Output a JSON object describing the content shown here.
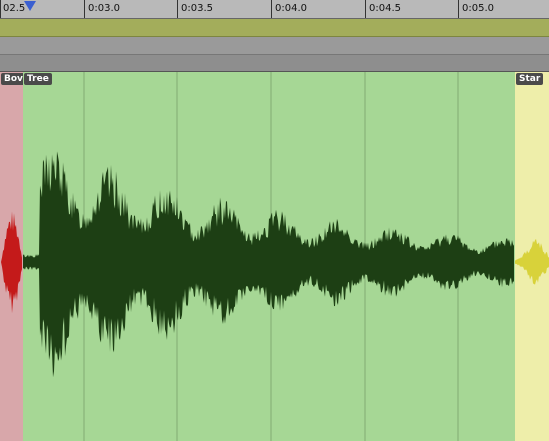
{
  "ruler": {
    "ticks": [
      "02.5",
      "0:03.0",
      "0:03.5",
      "0:04.0",
      "0:04.5",
      "0:05.0"
    ]
  },
  "regions": [
    {
      "label": "Bov",
      "color": "#d8a7aa",
      "wave_color": "#c41a1a"
    },
    {
      "label": "Tree",
      "color": "#a6d795",
      "wave_color": "#1d3f14"
    },
    {
      "label": "Star",
      "color": "#eeeeaa",
      "wave_color": "#d8d23a"
    }
  ],
  "colors": {
    "ruler_bg": "#b9b9b9",
    "olive_strip": "#a3ad5b",
    "playhead": "#3a5fd0"
  }
}
